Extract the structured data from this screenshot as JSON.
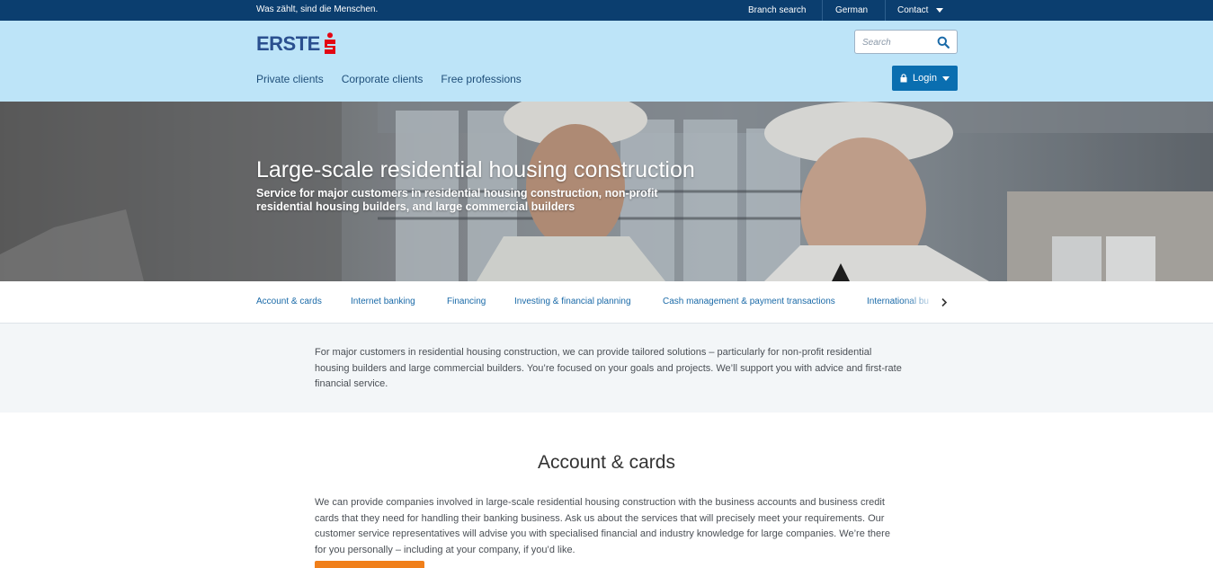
{
  "topbar": {
    "slogan": "Was zählt, sind die Menschen.",
    "branch_search": "Branch search",
    "language": "German",
    "contact": "Contact"
  },
  "header": {
    "logo_text": "ERSTE",
    "search_placeholder": "Search",
    "login_label": "Login",
    "nav": [
      "Private clients",
      "Corporate clients",
      "Free professions"
    ]
  },
  "hero": {
    "title": "Large-scale residential housing construction",
    "subtitle": "Service for major customers in residential housing construction, non-profit residential housing builders, and large commercial builders"
  },
  "tabs": [
    "Account & cards",
    "Internet banking",
    "Financing",
    "Investing & financial planning",
    "Cash management & payment transactions",
    "International bu"
  ],
  "intro": {
    "text": "For major customers in residential housing construction, we can provide tailored solutions – particularly for non-profit residential housing builders and large commercial builders. You’re focused on your goals and projects. We’ll support you with advice and first-rate financial service."
  },
  "account_cards": {
    "title": "Account & cards",
    "body": "We can provide companies involved in large-scale residential housing construction with the business accounts and business credit cards that they need for handling their banking business. Ask us about the services that will precisely meet your requirements. Our customer service representatives will advise you with specialised financial and industry knowledge for large companies. We’re there for you personally – including at your company, if you’d like."
  },
  "colors": {
    "topbar": "#0b3e6f",
    "header": "#bde4f8",
    "login_button": "#0a6eb0",
    "logo_red": "#e30613",
    "cta_orange": "#f07f1a"
  }
}
